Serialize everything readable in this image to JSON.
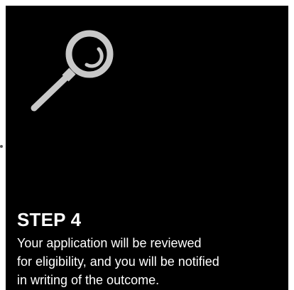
{
  "card": {
    "icon": "magnifying-glass-icon",
    "title": "STEP 4",
    "description_lines": [
      "Your application will be reviewed",
      "for eligibility, and you will be notified",
      "in writing of the outcome."
    ]
  },
  "colors": {
    "card_background": "#000000",
    "text": "#ffffff",
    "icon": "#c8c8c8"
  }
}
